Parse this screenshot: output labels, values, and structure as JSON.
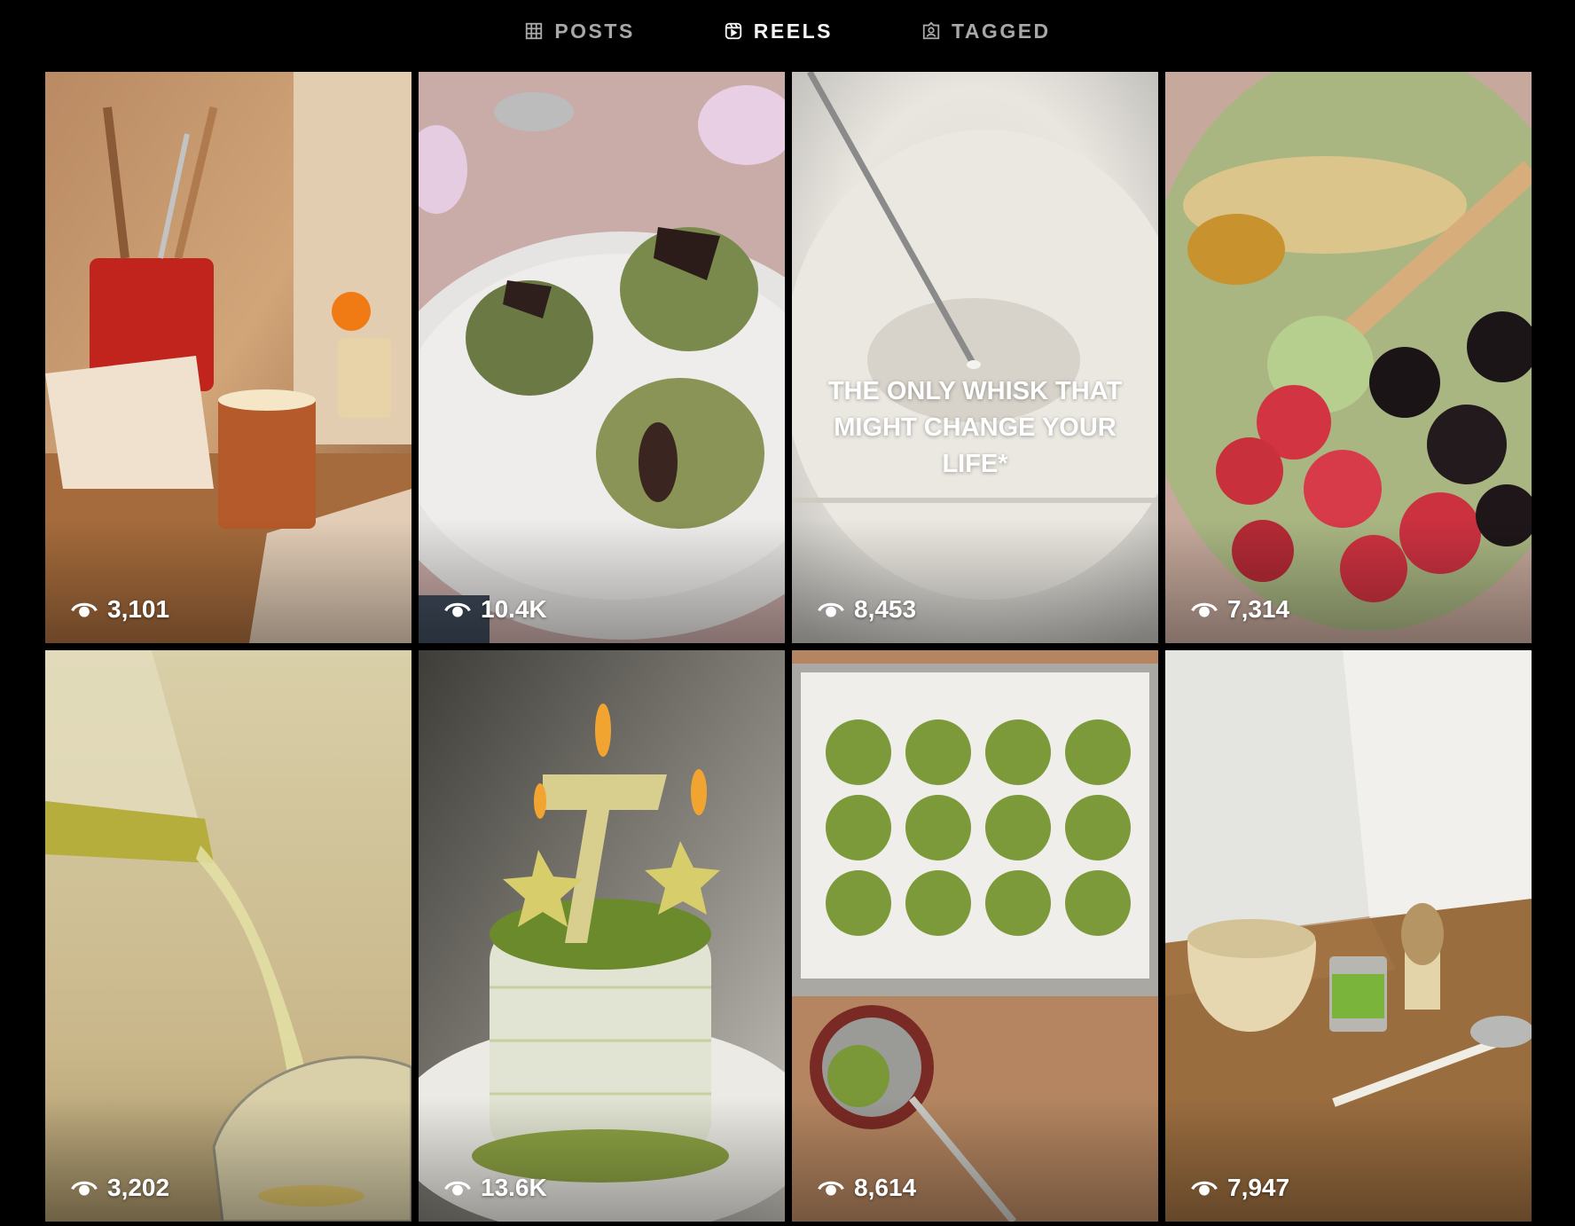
{
  "tabs": [
    {
      "label": "POSTS",
      "icon": "grid-icon",
      "active": false
    },
    {
      "label": "REELS",
      "icon": "reels-icon",
      "active": true
    },
    {
      "label": "TAGGED",
      "icon": "tagged-icon",
      "active": false
    }
  ],
  "reels": [
    {
      "views": "3,101",
      "scene": "kitchen-coffee-mug"
    },
    {
      "views": "10.4K",
      "scene": "matcha-cookies-plate"
    },
    {
      "views": "8,453",
      "scene": "milk-whisk",
      "overlay_text": "THE ONLY WHISK THAT MIGHT CHANGE YOUR LIFE*"
    },
    {
      "views": "7,314",
      "scene": "matcha-bowl-berries"
    },
    {
      "views": "3,202",
      "scene": "pouring-tea"
    },
    {
      "views": "13.6K",
      "scene": "matcha-birthday-cake"
    },
    {
      "views": "8,614",
      "scene": "matcha-cookies-tray"
    },
    {
      "views": "7,947",
      "scene": "matcha-bowl-tin-whisk"
    }
  ],
  "icons": {
    "views": "eye-icon"
  },
  "colors": {
    "background": "#000000",
    "tab_active": "#f5f5f5",
    "tab_inactive": "#a8a8a8"
  }
}
